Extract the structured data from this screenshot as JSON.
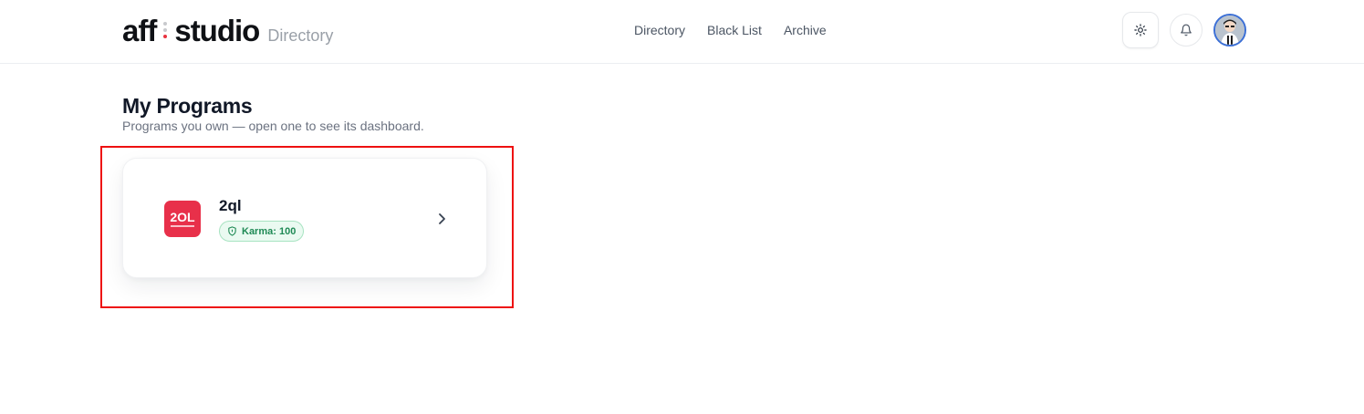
{
  "header": {
    "brand_left": "aff",
    "brand_right": "studio",
    "brand_sub": "Directory",
    "nav": [
      {
        "label": "Directory"
      },
      {
        "label": "Black List"
      },
      {
        "label": "Archive"
      }
    ],
    "icons": {
      "theme": "sun-icon",
      "notifications": "bell-icon",
      "avatar": "user-avatar"
    }
  },
  "main": {
    "title": "My Programs",
    "subtitle": "Programs you own — open one to see its dashboard.",
    "programs": [
      {
        "name": "2ql",
        "logo_text": "2OL",
        "logo_color": "#e8304a",
        "karma_label": "Karma: 100"
      }
    ]
  },
  "colors": {
    "accent_red": "#e8323f",
    "karma_green": "#1f8a55",
    "karma_bg": "#eafaf1",
    "highlight": "#ee1111"
  }
}
